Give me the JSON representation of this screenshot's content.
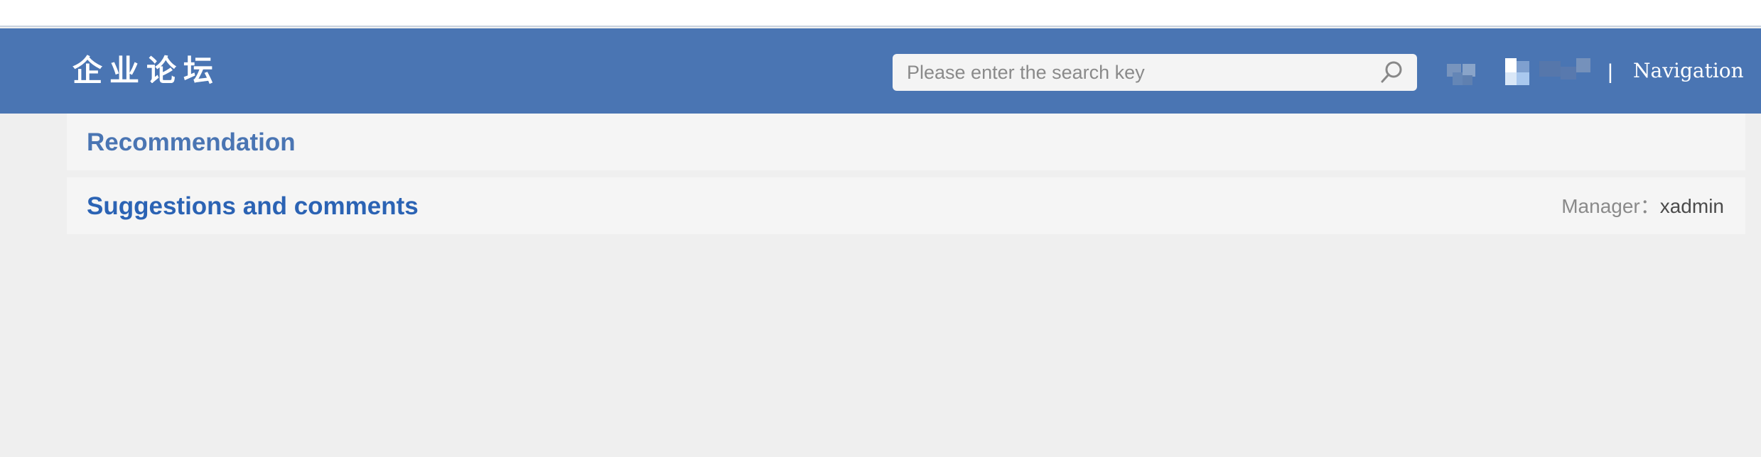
{
  "header": {
    "logo_text": "企业论坛",
    "search": {
      "placeholder": "Please enter the search key",
      "value": ""
    },
    "separator": "|",
    "navigation_label": "Navigation",
    "bg_color": "#4a75b3"
  },
  "sections": {
    "recommendation": {
      "title": "Recommendation"
    },
    "forum": {
      "title": "Suggestions and comments",
      "manager_label": "Manager：",
      "manager_name": "xadmin"
    }
  },
  "icons": {
    "search": "search-icon",
    "avatar": "blurred-user-avatar"
  }
}
